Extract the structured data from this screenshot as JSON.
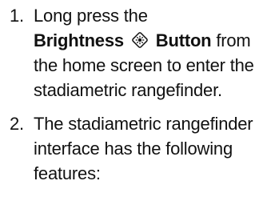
{
  "steps": [
    {
      "number": "1.",
      "text_before": "Long press the",
      "bold_label_a": "Brightness",
      "icon": "brightness-icon",
      "bold_label_b": "Button",
      "text_after": "from the home screen to enter the stadiametric rangefinder."
    },
    {
      "number": "2.",
      "text": "The stadiametric rangefinder interface has the following features:"
    }
  ]
}
